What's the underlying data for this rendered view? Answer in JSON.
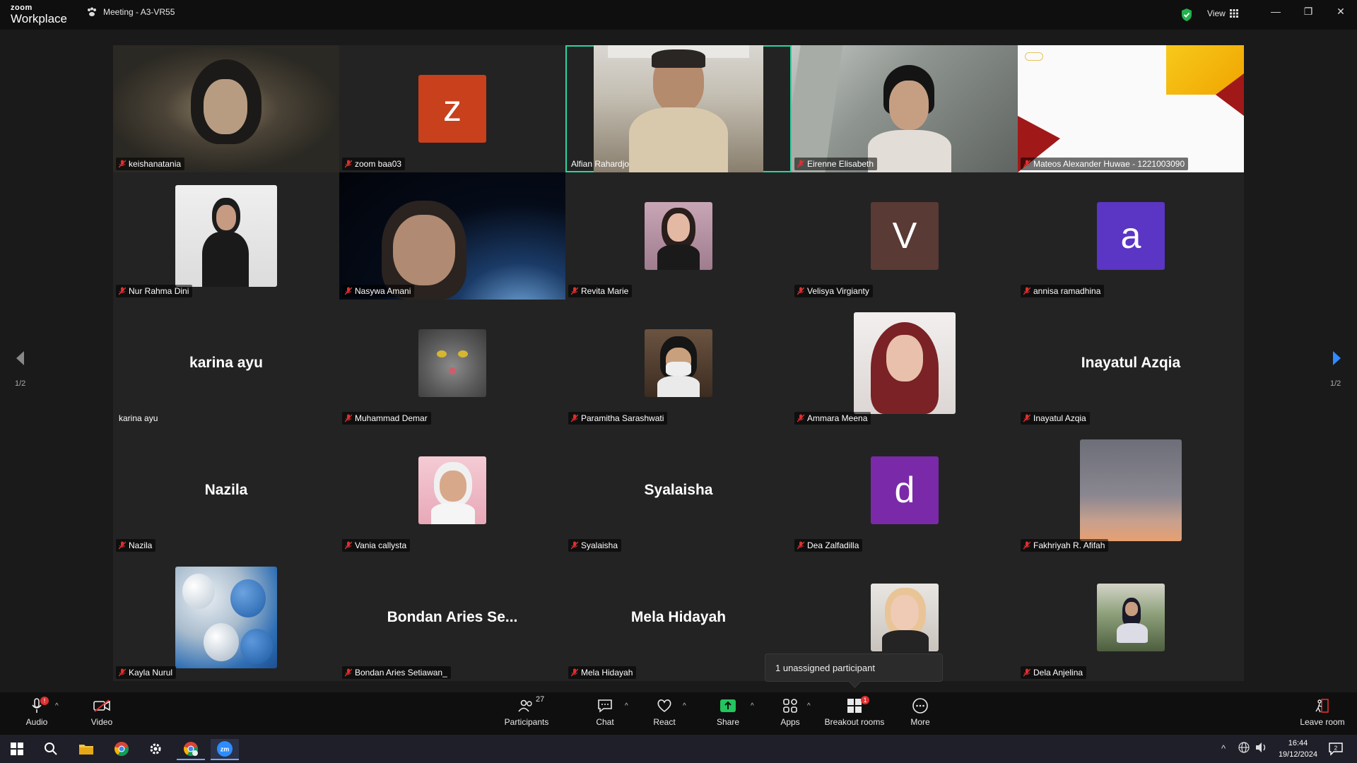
{
  "app": {
    "brand_top": "zoom",
    "brand_bottom": "Workplace",
    "meeting_title": "Meeting - A3-VR55",
    "view_label": "View"
  },
  "gallery": {
    "tiles": [
      {
        "name": "keishanatania"
      },
      {
        "name": "zoom baa03",
        "letter": "z",
        "color": "#c8401c"
      },
      {
        "name": "Alfian Rahardjo"
      },
      {
        "name": "Eirenne Elisabeth"
      },
      {
        "name": "Mateos Alexander Huwae - 1221003090"
      },
      {
        "name": "Nur Rahma Dini"
      },
      {
        "name": "Nasywa Amani"
      },
      {
        "name": "Revita Marie"
      },
      {
        "name": "Velisya Virgianty",
        "letter": "V",
        "color": "#5a3a34"
      },
      {
        "name": "annisa ramadhina",
        "letter": "a",
        "color": "#5b35c4"
      },
      {
        "name": "karina ayu",
        "display": "karina ayu"
      },
      {
        "name": "Muhammad Demar"
      },
      {
        "name": "Paramitha Sarashwati"
      },
      {
        "name": "Ammara Meena"
      },
      {
        "name": "Inayatul Azqia",
        "display": "Inayatul Azqia"
      },
      {
        "name": "Nazila",
        "display": "Nazila"
      },
      {
        "name": "Vania callysta"
      },
      {
        "name": "Syalaisha",
        "display": "Syalaisha"
      },
      {
        "name": "Dea Zalfadilla",
        "letter": "d",
        "color": "#7a2aa8"
      },
      {
        "name": "Fakhriyah R. Afifah"
      },
      {
        "name": "Kayla Nurul"
      },
      {
        "name": "Bondan Aries Setiawan_",
        "display": "Bondan Aries Se..."
      },
      {
        "name": "Mela Hidayah",
        "display": "Mela Hidayah"
      },
      {
        "name": ""
      },
      {
        "name": "Dela Anjelina"
      }
    ],
    "page_left": "1/2",
    "page_right": "1/2"
  },
  "tooltip": {
    "text": "1 unassigned participant"
  },
  "toolbar": {
    "audio": "Audio",
    "video": "Video",
    "participants": "Participants",
    "participants_count": "27",
    "chat": "Chat",
    "react": "React",
    "share": "Share",
    "apps": "Apps",
    "breakout": "Breakout rooms",
    "breakout_badge": "1",
    "more": "More",
    "leave": "Leave room"
  },
  "taskbar": {
    "time": "16:44",
    "date": "19/12/2024",
    "notif_count": "2"
  },
  "colors": {
    "accent_green": "#2dd3a0",
    "mute_red": "#e02e2e",
    "share_green": "#22c55e"
  }
}
